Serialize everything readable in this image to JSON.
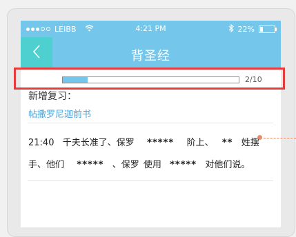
{
  "status_bar": {
    "carrier": "LEIBB",
    "time": "4:21 PM",
    "battery_percent": "22%",
    "battery_level": 0.22,
    "icons": [
      "signal-dots-icon",
      "wifi-icon",
      "bluetooth-icon",
      "battery-icon"
    ]
  },
  "navbar": {
    "title": "背圣经",
    "back_icon": "chevron-left-icon"
  },
  "progress": {
    "count": "2/10",
    "fraction": 0.14
  },
  "review": {
    "section_label": "新增复习：",
    "book": "帖撒罗尼迦前书"
  },
  "verse": {
    "time": "21:40",
    "t1": "千夫长准了、保罗",
    "b1": "*****",
    "t2": "阶上、",
    "b2": "**",
    "t3": "姓摆手、他们",
    "b3": "*****",
    "t4": "、保罗 使用",
    "b4": "*****",
    "t5": "对他们说。"
  },
  "colors": {
    "accent": "#74c7ea",
    "back_button": "#4fd0d0",
    "highlight": "#e43c3c",
    "link": "#4aa3d8"
  }
}
